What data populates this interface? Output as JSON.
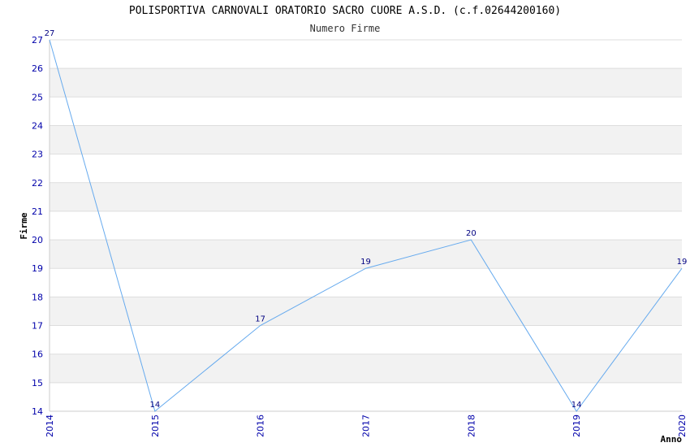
{
  "chart_data": {
    "type": "line",
    "title": "POLISPORTIVA CARNOVALI ORATORIO SACRO CUORE A.S.D. (c.f.02644200160)",
    "subtitle": "Numero Firme",
    "xlabel": "Anno",
    "ylabel": "Firme",
    "x": [
      "2014",
      "2015",
      "2016",
      "2017",
      "2018",
      "2019",
      "2020"
    ],
    "series": [
      {
        "values": [
          27,
          14,
          17,
          19,
          20,
          14,
          19
        ]
      }
    ],
    "ylim": [
      14,
      27
    ],
    "yticks": [
      14,
      15,
      16,
      17,
      18,
      19,
      20,
      21,
      22,
      23,
      24,
      25,
      26,
      27
    ],
    "grid": "horizontal bands",
    "colors": {
      "line": "#66aaee",
      "band": "#f2f2f2",
      "tick": "#0000aa",
      "label": "#000080"
    }
  }
}
